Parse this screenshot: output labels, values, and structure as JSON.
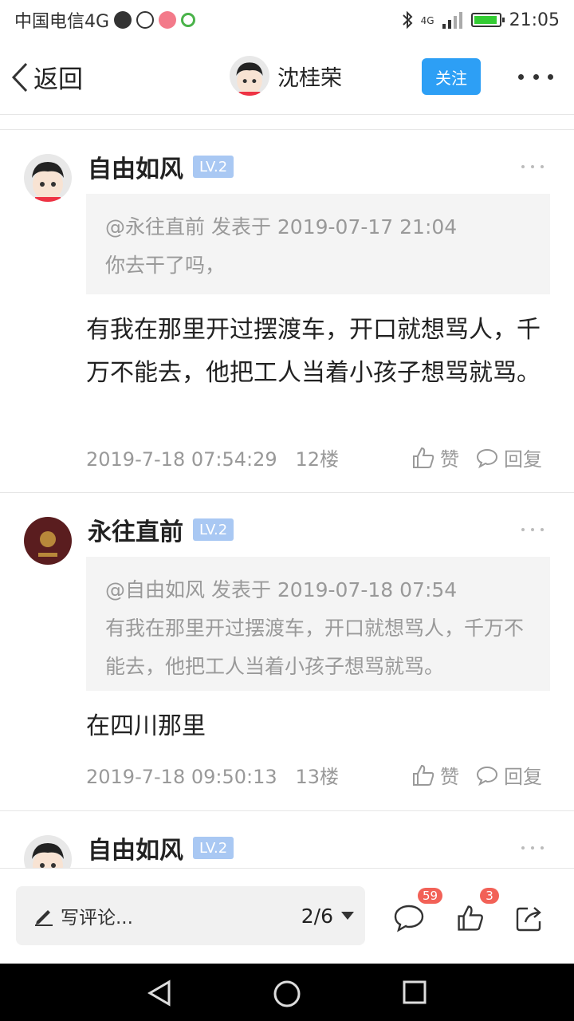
{
  "status_bar": {
    "carrier": "中国电信4G",
    "time": "21:05",
    "network_label": "4G"
  },
  "nav": {
    "back_label": "返回",
    "title": "沈桂荣",
    "follow_label": "关注"
  },
  "comments": [
    {
      "name": "自由如风",
      "level": "LV.2",
      "quote_header": "@永往直前 发表于 2019-07-17 21:04",
      "quote_text": "你去干了吗，",
      "body": "有我在那里开过摆渡车，开口就想骂人，千万不能去，他把工人当着小孩子想骂就骂。",
      "timestamp": "2019-7-18 07:54:29",
      "floor": "12楼",
      "like_label": "赞",
      "reply_label": "回复"
    },
    {
      "name": "永往直前",
      "level": "LV.2",
      "quote_header": "@自由如风 发表于 2019-07-18 07:54",
      "quote_text": "有我在那里开过摆渡车，开口就想骂人，千万不能去，他把工人当着小孩子想骂就骂。",
      "body": "在四川那里",
      "timestamp": "2019-7-18 09:50:13",
      "floor": "13楼",
      "like_label": "赞",
      "reply_label": "回复"
    },
    {
      "name": "自由如风",
      "level": "LV.2"
    }
  ],
  "bottom_bar": {
    "comment_placeholder": "写评论...",
    "page_indicator": "2/6",
    "comment_count": "59",
    "like_count": "3"
  },
  "colors": {
    "accent": "#2d9ff5",
    "level_badge": "#a9c8f3",
    "count_badge": "#f26157"
  }
}
